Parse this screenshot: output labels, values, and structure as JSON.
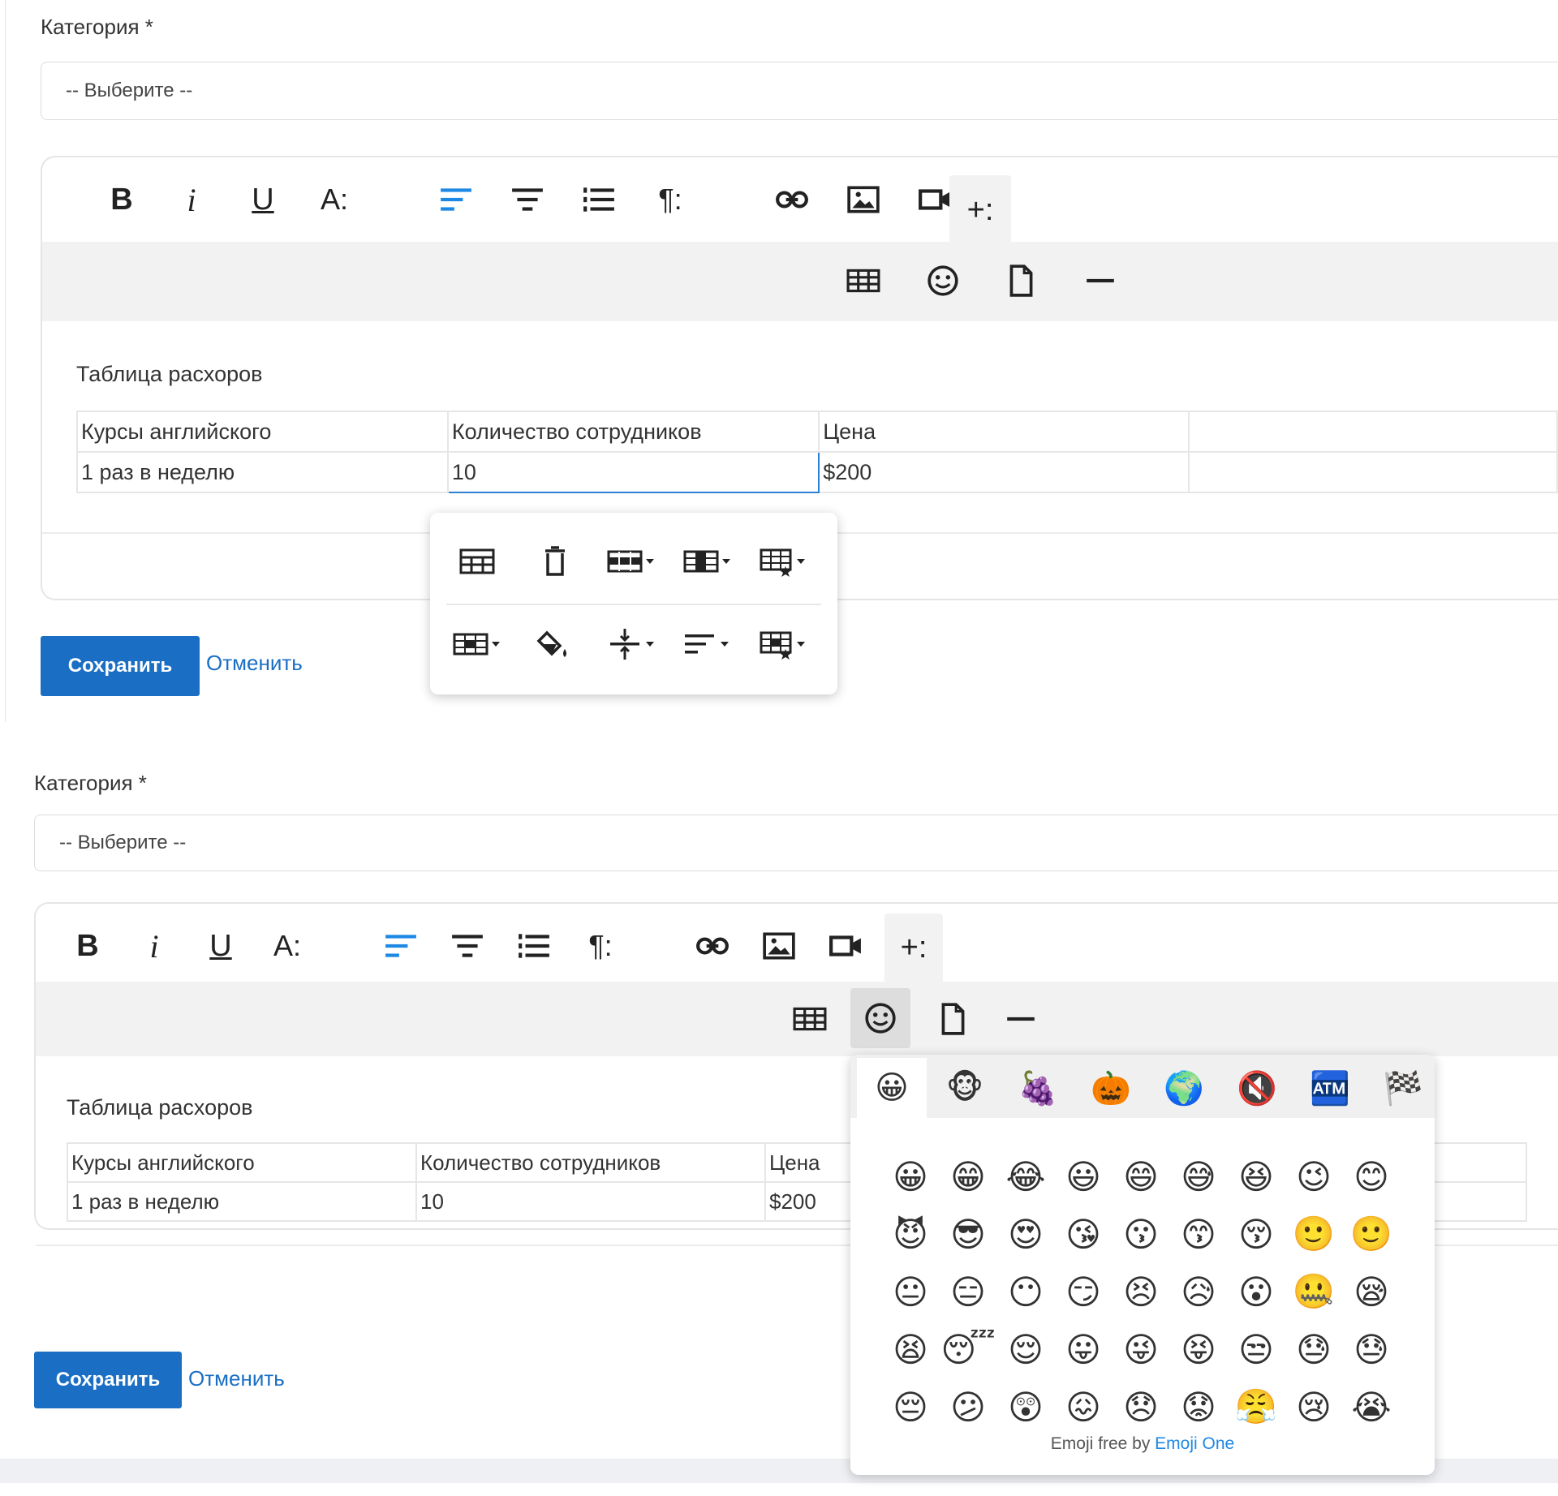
{
  "form": {
    "category_label": "Категория *",
    "category_select_value": "-- Выберите --",
    "save_label": "Сохранить",
    "cancel_label": "Отменить"
  },
  "toolbar": {
    "bold": "B",
    "italic": "i",
    "underline": "U",
    "font_size": "A:",
    "paragraph": "¶:",
    "more": "+:"
  },
  "document": {
    "title": "Таблица расхоров",
    "table": {
      "rows": [
        [
          "Курсы английского",
          "Количество сотрудников",
          "Цена",
          ""
        ],
        [
          "1 раз в неделю",
          "10",
          "$200",
          ""
        ]
      ]
    }
  },
  "emoji_picker": {
    "categories": [
      "😀",
      "🐵",
      "🍇",
      "🎃",
      "🌍",
      "🔇",
      "🏧",
      "🏁"
    ],
    "rows": [
      [
        "😀",
        "😁",
        "😂",
        "😃",
        "😄",
        "😅",
        "😆",
        "😉",
        "😊"
      ],
      [
        "😈",
        "😎",
        "😍",
        "😘",
        "😗",
        "😙",
        "😚",
        "🙂",
        "🙂"
      ],
      [
        "😐",
        "😑",
        "😶",
        "😏",
        "😣",
        "😥",
        "😮",
        "🤐",
        "😪"
      ],
      [
        "😫",
        "😴",
        "😌",
        "😛",
        "😜",
        "😝",
        "😒",
        "😓",
        "😓"
      ],
      [
        "😔",
        "😕",
        "😲",
        "😖",
        "😞",
        "😟",
        "😤",
        "😢",
        "😭"
      ]
    ],
    "credit_prefix": "Emoji free by ",
    "credit_link": "Emoji One"
  },
  "colors": {
    "accent_blue": "#1a6fc4",
    "active_icon_blue": "#1e88e5",
    "toolbar_bg": "#f2f2f2",
    "selected_cell_border": "#2b7fd4"
  }
}
